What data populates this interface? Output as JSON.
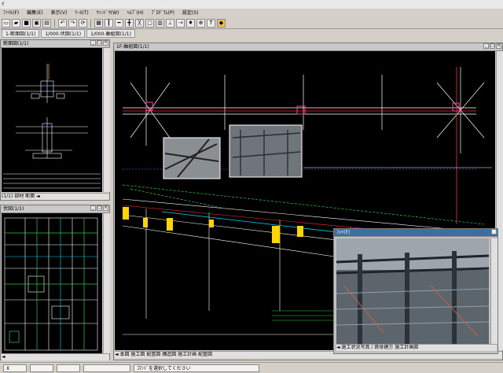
{
  "app": {
    "title": "ｲ"
  },
  "menu": {
    "items": [
      "ﾌｧｲﾙ(F)",
      "編集(E)",
      "表示(V)",
      "ﾂｰﾙ(T)",
      "ｳｨﾝﾄﾞｳ(W)",
      "ﾍﾙﾌﾟ(H)",
      "ﾌﾟﾛｸﾞﾗﾑ(P)",
      "設定(S)"
    ]
  },
  "tabs": {
    "items": [
      "1-断面図(1/1)",
      "1/000-伏図(1/1)",
      "1/000-軸組図(1/1)"
    ]
  },
  "windows": {
    "section": {
      "title": "断面図(1/1)",
      "scroll_text": "(1/1) 部材 断面 ◄"
    },
    "plan": {
      "title": "伏図(1/1)",
      "scroll_text": "◄"
    },
    "elevation": {
      "title": "1F-軸組図(1/1)",
      "scroll_text": "◄ 本図 施工図 配置図 構造図 施工計画 配置図"
    },
    "photo": {
      "title": "ﾌｫﾄ(F)",
      "caption": "◄ 施工状況写真 / 鉄骨建方 施工計画図"
    }
  },
  "status": {
    "coord": "X",
    "hint": "ｺﾏﾝﾄﾞを選択してください"
  }
}
